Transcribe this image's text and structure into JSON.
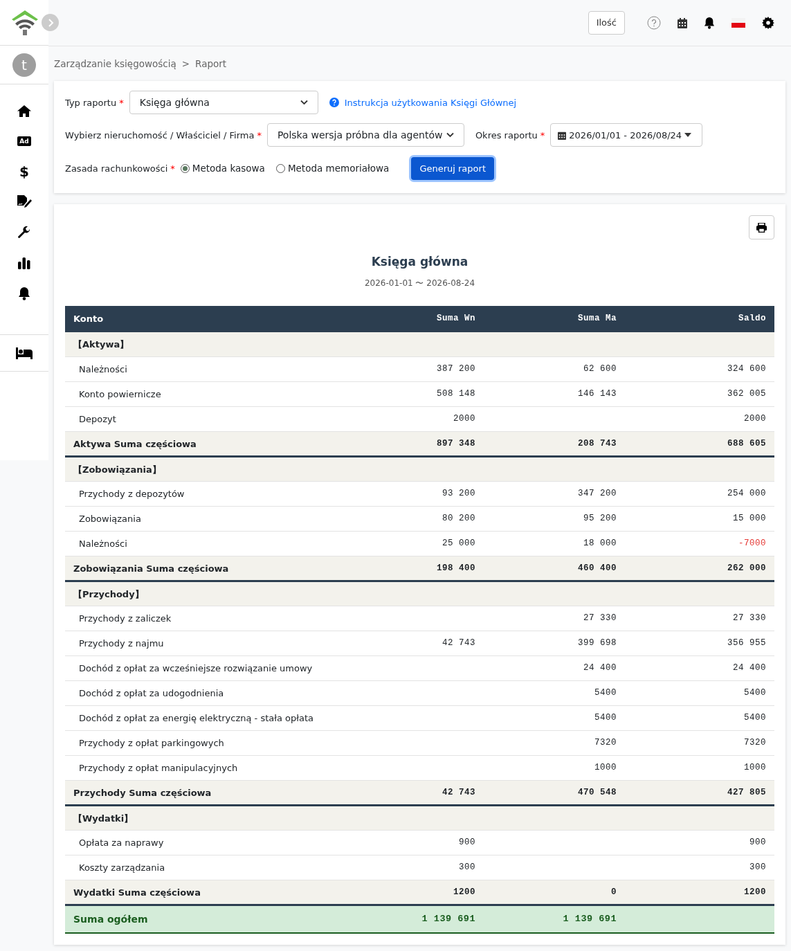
{
  "sidebar": {
    "avatar": "t",
    "items": [
      {
        "kind": "home"
      },
      {
        "kind": "ad",
        "text": "Ad"
      },
      {
        "kind": "dollar",
        "text": "$"
      },
      {
        "kind": "sign"
      },
      {
        "kind": "wrench"
      },
      {
        "kind": "chart"
      },
      {
        "kind": "bell"
      }
    ],
    "bottom": [
      {
        "kind": "bed"
      }
    ]
  },
  "topbar": {
    "quantity_button": "Ilość"
  },
  "breadcrumb": [
    "Zarządzanie księgowością",
    "Raport"
  ],
  "breadcrumb_separator": ">",
  "form": {
    "required_mark": "*",
    "report_type_label": "Typ raportu",
    "report_type_value": "Księga główna",
    "help_link": "Instrukcja użytkowania Księgi Głównej",
    "property_label": "Wybierz nieruchomość / Właściciel / Firma",
    "property_value": "Polska wersja próbna dla agentów",
    "period_label": "Okres raportu",
    "period_value": "2026/01/01 - 2026/08/24",
    "method_label": "Zasada rachunkowości",
    "methods": [
      {
        "label": "Metoda kasowa",
        "selected": true
      },
      {
        "label": "Metoda memoriałowa",
        "selected": false
      }
    ],
    "generate_button": "Generuj raport"
  },
  "report": {
    "title": "Księga główna",
    "range": "2026-01-01 〜 2026-08-24",
    "table": {
      "columns": [
        "Konto",
        "Suma Wn",
        "Suma Ma",
        "Saldo"
      ],
      "rows": [
        {
          "kind": "group",
          "name": "【Aktywa】"
        },
        {
          "kind": "item",
          "name": "Należności",
          "wn": "387 200",
          "ma": "62 600",
          "saldo": "324 600",
          "negative": false
        },
        {
          "kind": "item",
          "name": "Konto powiernicze",
          "wn": "508 148",
          "ma": "146 143",
          "saldo": "362 005",
          "negative": false
        },
        {
          "kind": "item",
          "name": "Depozyt",
          "wn": "2000",
          "saldo": "2000",
          "negative": false
        },
        {
          "kind": "subtotal",
          "name": "Aktywa Suma częściowa",
          "wn": "897 348",
          "ma": "208 743",
          "saldo": "688 605"
        },
        {
          "kind": "group",
          "name": "【Zobowiązania】"
        },
        {
          "kind": "item",
          "name": "Przychody z depozytów",
          "wn": "93 200",
          "ma": "347 200",
          "saldo": "254 000",
          "negative": false
        },
        {
          "kind": "item",
          "name": "Zobowiązania",
          "wn": "80 200",
          "ma": "95 200",
          "saldo": "15 000",
          "negative": false
        },
        {
          "kind": "item",
          "name": "Należności",
          "wn": "25 000",
          "ma": "18 000",
          "saldo": "-7000",
          "negative": true
        },
        {
          "kind": "subtotal",
          "name": "Zobowiązania Suma częściowa",
          "wn": "198 400",
          "ma": "460 400",
          "saldo": "262 000"
        },
        {
          "kind": "group",
          "name": "【Przychody】"
        },
        {
          "kind": "item",
          "name": "Przychody z zaliczek",
          "ma": "27 330",
          "saldo": "27 330",
          "negative": false
        },
        {
          "kind": "item",
          "name": "Przychody z najmu",
          "wn": "42 743",
          "ma": "399 698",
          "saldo": "356 955",
          "negative": false
        },
        {
          "kind": "item",
          "name": "Dochód z opłat za wcześniejsze rozwiązanie umowy",
          "ma": "24 400",
          "saldo": "24 400",
          "negative": false
        },
        {
          "kind": "item",
          "name": "Dochód z opłat za udogodnienia",
          "ma": "5400",
          "saldo": "5400",
          "negative": false
        },
        {
          "kind": "item",
          "name": "Dochód z opłat za energię elektryczną - stała opłata",
          "ma": "5400",
          "saldo": "5400",
          "negative": false
        },
        {
          "kind": "item",
          "name": "Przychody z opłat parkingowych",
          "ma": "7320",
          "saldo": "7320",
          "negative": false
        },
        {
          "kind": "item",
          "name": "Przychody z opłat manipulacyjnych",
          "ma": "1000",
          "saldo": "1000",
          "negative": false
        },
        {
          "kind": "subtotal",
          "name": "Przychody Suma częściowa",
          "wn": "42 743",
          "ma": "470 548",
          "saldo": "427 805"
        },
        {
          "kind": "group",
          "name": "【Wydatki】"
        },
        {
          "kind": "item",
          "name": "Opłata za naprawy",
          "wn": "900",
          "saldo": "900",
          "negative": false
        },
        {
          "kind": "item",
          "name": "Koszty zarządzania",
          "wn": "300",
          "saldo": "300",
          "negative": false
        },
        {
          "kind": "subtotal",
          "name": "Wydatki Suma częściowa",
          "wn": "1200",
          "ma": "0",
          "saldo": "1200"
        },
        {
          "kind": "total",
          "name": "Suma ogółem",
          "wn": "1 139 691",
          "ma": "1 139 691"
        }
      ]
    }
  }
}
